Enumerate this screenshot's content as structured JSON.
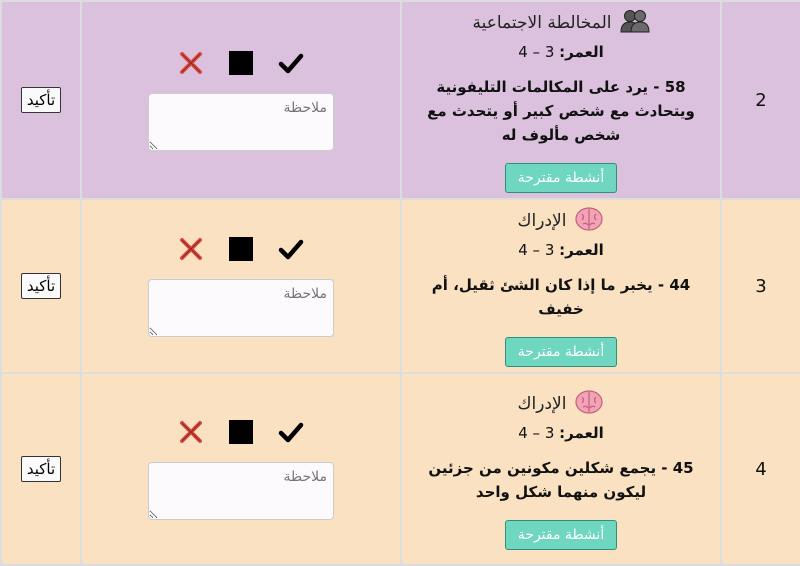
{
  "colors": {
    "row1": "#dcc1df",
    "row2": "#f9e1c1",
    "row3": "#f9e1c1",
    "suggest_bg": "#6fd6c0",
    "x_red": "#d9483e"
  },
  "rows": [
    {
      "number": "2",
      "category": "المخالطة الاجتماعية",
      "category_icon": "people-icon",
      "age_label": "العمر:",
      "age_value": "3 – 4",
      "question": "58 - يرد على المكالمات التليفونية ويتحادث مع شخص كبير أو يتحدث مع شخص مألوف له",
      "suggest_label": "أنشطة مقترحة",
      "note_placeholder": "ملاحظة",
      "confirm_label": "تأكيد"
    },
    {
      "number": "3",
      "category": "الإدراك",
      "category_icon": "brain-icon",
      "age_label": "العمر:",
      "age_value": "3 – 4",
      "question": "44 - يخبر ما إذا كان الشئ ثقيل، أم خفيف",
      "suggest_label": "أنشطة مقترحة",
      "note_placeholder": "ملاحظة",
      "confirm_label": "تأكيد"
    },
    {
      "number": "4",
      "category": "الإدراك",
      "category_icon": "brain-icon",
      "age_label": "العمر:",
      "age_value": "3 – 4",
      "question": "45 - يجمع شكلين مكونين من جزئين ليكون منهما شكل واحد",
      "suggest_label": "أنشطة مقترحة",
      "note_placeholder": "ملاحظة",
      "confirm_label": "تأكيد"
    }
  ]
}
